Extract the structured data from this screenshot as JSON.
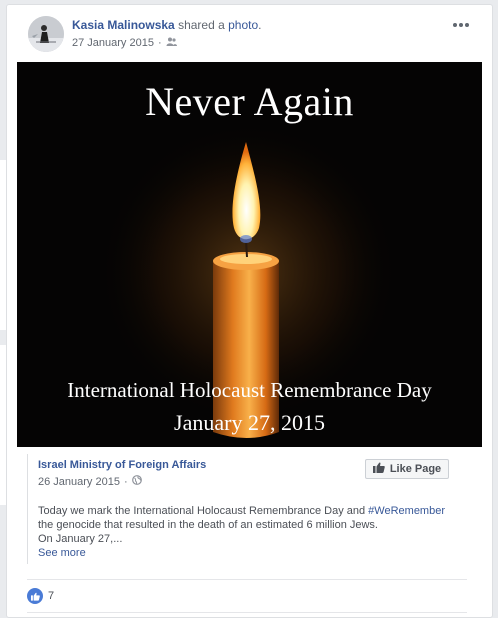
{
  "post": {
    "author": "Kasia Malinowska",
    "action_text": "shared a",
    "action_link": "photo",
    "period": ".",
    "date": "27 January 2015",
    "separator": "·",
    "audience_icon": "friends-icon",
    "more_icon": "more-options-icon"
  },
  "photo": {
    "title": "Never Again",
    "caption_line1": "International Holocaust Remembrance Day",
    "caption_line2": "January 27, 2015"
  },
  "shared": {
    "page_name": "Israel Ministry of Foreign Affairs",
    "date": "26 January 2015",
    "separator": "·",
    "audience_icon": "globe-icon",
    "like_page_label": "Like Page",
    "like_icon": "thumbs-up-icon",
    "text_before_hashtag": "Today we mark the International Holocaust Remembrance Day and ",
    "hashtag": "#WeRemember",
    "text_after_hashtag": " the genocide that resulted in the death of an estimated 6 million Jews.",
    "text_line3": "On January 27,...",
    "see_more": "See more"
  },
  "reactions": {
    "icon": "like-reaction-icon",
    "count": "7"
  },
  "colors": {
    "link": "#385898",
    "meta": "#616770",
    "body_text": "#4b4f56",
    "like_badge": "#4a7bd6",
    "background": "#e9ebee"
  }
}
